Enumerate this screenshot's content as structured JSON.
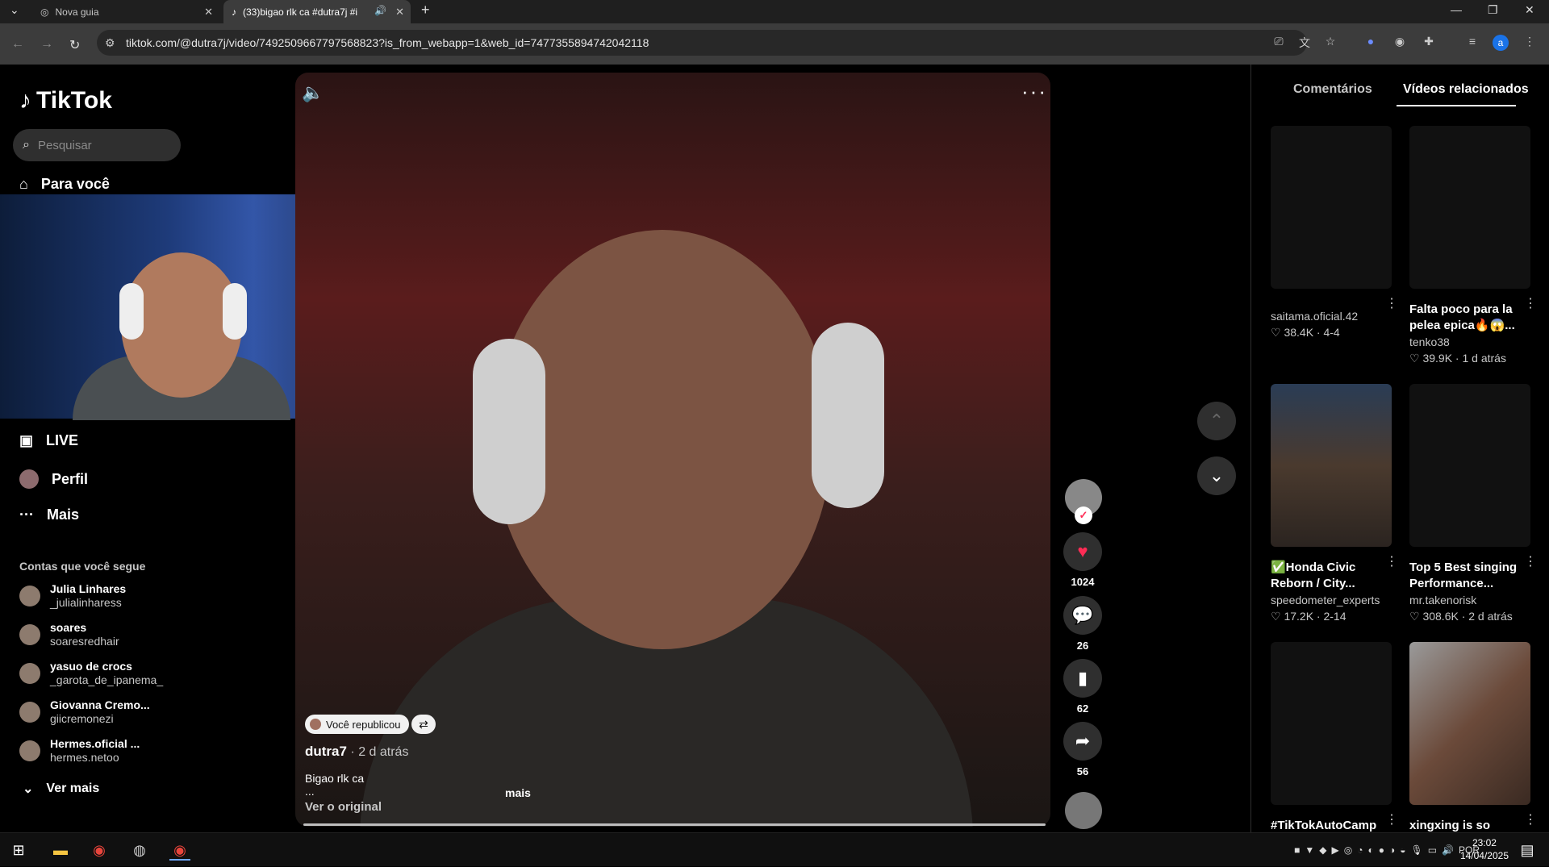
{
  "browser": {
    "tabs": [
      {
        "title": "Nova guia"
      },
      {
        "title": "(33)bigao rlk ca #dutra7j #i"
      }
    ],
    "url": "tiktok.com/@dutra7j/video/7492509667797568823?is_from_webapp=1&web_id=7477355894742042118"
  },
  "sidebar": {
    "logo": "TikTok",
    "search_placeholder": "Pesquisar",
    "nav": [
      {
        "label": "Para você",
        "icon": "home-icon"
      },
      {
        "label": "LIVE",
        "icon": "live-icon"
      },
      {
        "label": "Perfil",
        "icon": "profile-icon"
      },
      {
        "label": "Mais",
        "icon": "more-icon"
      }
    ],
    "following_title": "Contas que você segue",
    "accounts": [
      {
        "name": "Julia Linhares",
        "handle": "_julialinharess"
      },
      {
        "name": "soares",
        "handle": "soaresredhair"
      },
      {
        "name": "yasuo de crocs",
        "handle": "_garota_de_ipanema_"
      },
      {
        "name": "Giovanna Cremo...",
        "handle": "giicremonezi"
      },
      {
        "name": "Hermes.oficial ...",
        "handle": "hermes.netoo"
      }
    ],
    "see_more": "Ver mais"
  },
  "video": {
    "reposted_label": "Você republicou",
    "author": "dutra7",
    "time_ago": " · 2 d atrás",
    "description": "Bigao rlk ca",
    "description_more_line": "...",
    "more": "mais",
    "original": "Ver o original",
    "actions": {
      "likes": "1024",
      "comments": "26",
      "saves": "62",
      "shares": "56"
    }
  },
  "right_panel": {
    "tabs": [
      "Comentários",
      "Vídeos relacionados"
    ],
    "cards": [
      {
        "title": "",
        "user": "saitama.oficial.42",
        "stats": "♡ 38.4K · 4-4"
      },
      {
        "title": "Falta poco para la pelea epica🔥😱...",
        "user": "tenko38",
        "stats": "♡ 39.9K · 1 d atrás"
      },
      {
        "title": "✅Honda Civic Reborn / City...",
        "user": "speedometer_experts",
        "stats": "♡ 17.2K · 2-14"
      },
      {
        "title": "Top 5 Best singing Performance...",
        "user": "mr.takenorisk",
        "stats": "♡ 308.6K · 2 d atrás"
      },
      {
        "title": "#TikTokAutoCamp",
        "user": "",
        "stats": ""
      },
      {
        "title": "xingxing is so",
        "user": "",
        "stats": ""
      }
    ]
  },
  "taskbar": {
    "lang": "POR",
    "time": "23:02",
    "date": "14/04/2025"
  }
}
